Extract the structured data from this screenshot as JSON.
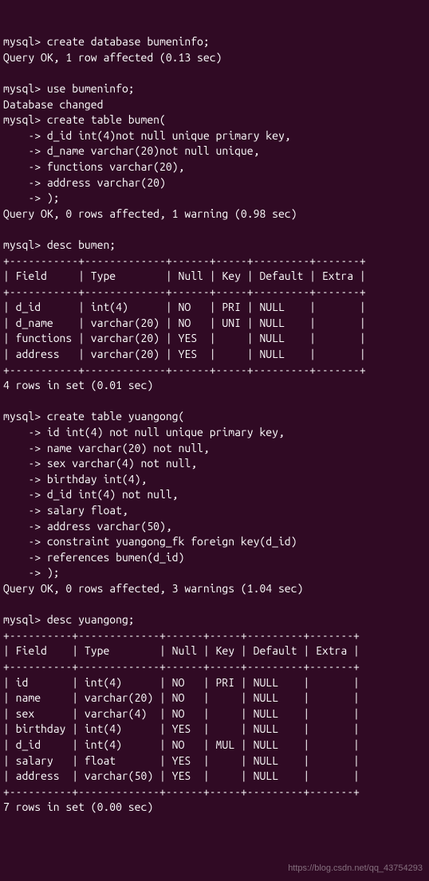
{
  "lines": {
    "l01": "mysql> create database bumeninfo;",
    "l02": "Query OK, 1 row affected (0.13 sec)",
    "l03": "",
    "l04": "mysql> use bumeninfo;",
    "l05": "Database changed",
    "l06": "mysql> create table bumen(",
    "l07": "    -> d_id int(4)not null unique primary key,",
    "l08": "    -> d_name varchar(20)not null unique,",
    "l09": "    -> functions varchar(20),",
    "l10": "    -> address varchar(20)",
    "l11": "    -> );",
    "l12": "Query OK, 0 rows affected, 1 warning (0.98 sec)",
    "l13": "",
    "l14": "mysql> desc bumen;",
    "l15": "+-----------+-------------+------+-----+---------+-------+",
    "l16": "| Field     | Type        | Null | Key | Default | Extra |",
    "l17": "+-----------+-------------+------+-----+---------+-------+",
    "l18": "| d_id      | int(4)      | NO   | PRI | NULL    |       |",
    "l19": "| d_name    | varchar(20) | NO   | UNI | NULL    |       |",
    "l20": "| functions | varchar(20) | YES  |     | NULL    |       |",
    "l21": "| address   | varchar(20) | YES  |     | NULL    |       |",
    "l22": "+-----------+-------------+------+-----+---------+-------+",
    "l23": "4 rows in set (0.01 sec)",
    "l24": "",
    "l25": "mysql> create table yuangong(",
    "l26": "    -> id int(4) not null unique primary key,",
    "l27": "    -> name varchar(20) not null,",
    "l28": "    -> sex varchar(4) not null,",
    "l29": "    -> birthday int(4),",
    "l30": "    -> d_id int(4) not null,",
    "l31": "    -> salary float,",
    "l32": "    -> address varchar(50),",
    "l33": "    -> constraint yuangong_fk foreign key(d_id)",
    "l34": "    -> references bumen(d_id)",
    "l35": "    -> );",
    "l36": "Query OK, 0 rows affected, 3 warnings (1.04 sec)",
    "l37": "",
    "l38": "mysql> desc yuangong;",
    "l39": "+----------+-------------+------+-----+---------+-------+",
    "l40": "| Field    | Type        | Null | Key | Default | Extra |",
    "l41": "+----------+-------------+------+-----+---------+-------+",
    "l42": "| id       | int(4)      | NO   | PRI | NULL    |       |",
    "l43": "| name     | varchar(20) | NO   |     | NULL    |       |",
    "l44": "| sex      | varchar(4)  | NO   |     | NULL    |       |",
    "l45": "| birthday | int(4)      | YES  |     | NULL    |       |",
    "l46": "| d_id     | int(4)      | NO   | MUL | NULL    |       |",
    "l47": "| salary   | float       | YES  |     | NULL    |       |",
    "l48": "| address  | varchar(50) | YES  |     | NULL    |       |",
    "l49": "+----------+-------------+------+-----+---------+-------+",
    "l50": "7 rows in set (0.00 sec)"
  },
  "watermark": "https://blog.csdn.net/qq_43754293"
}
